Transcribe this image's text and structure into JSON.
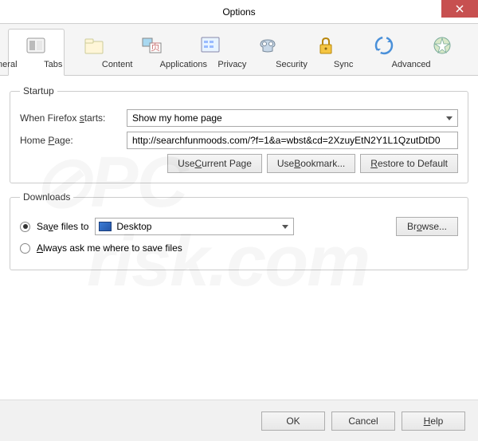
{
  "window": {
    "title": "Options"
  },
  "toolbar": {
    "items": [
      {
        "label": "General"
      },
      {
        "label": "Tabs"
      },
      {
        "label": "Content"
      },
      {
        "label": "Applications"
      },
      {
        "label": "Privacy"
      },
      {
        "label": "Security"
      },
      {
        "label": "Sync"
      },
      {
        "label": "Advanced"
      }
    ]
  },
  "startup": {
    "legend": "Startup",
    "when_label": "When Firefox starts:",
    "when_value": "Show my home page",
    "homepage_label": "Home Page:",
    "homepage_value": "http://searchfunmoods.com/?f=1&a=wbst&cd=2XzuyEtN2Y1L1QzutDtD0",
    "use_current": "Use Current Page",
    "use_bookmark": "Use Bookmark...",
    "restore_default": "Restore to Default"
  },
  "downloads": {
    "legend": "Downloads",
    "save_to_label": "Save files to",
    "save_location": "Desktop",
    "always_ask_label": "Always ask me where to save files",
    "browse": "Browse..."
  },
  "footer": {
    "ok": "OK",
    "cancel": "Cancel",
    "help": "Help"
  }
}
